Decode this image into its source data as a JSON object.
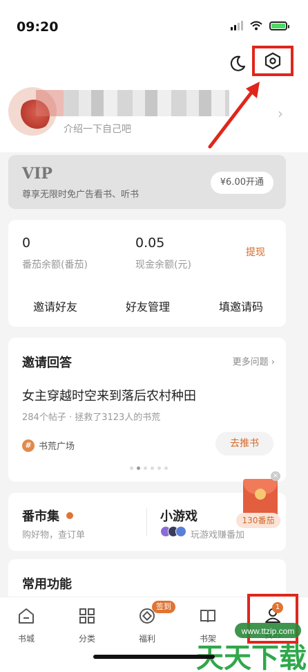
{
  "status_bar": {
    "time": "09:20"
  },
  "profile": {
    "bio": "介绍一下自己吧"
  },
  "vip": {
    "title": "VIP",
    "subtitle": "尊享无限时免广告看书、听书",
    "button": "¥6.00开通"
  },
  "wallet": {
    "tomato_balance": "0",
    "tomato_label": "番茄余额(番茄)",
    "cash_balance": "0.05",
    "cash_label": "现金余额(元)",
    "withdraw": "提现",
    "actions": [
      "邀请好友",
      "好友管理",
      "填邀请码"
    ]
  },
  "invite_answer": {
    "title": "邀请回答",
    "more": "更多问题",
    "question": "女主穿越时空来到落后农村种田",
    "meta": "284个帖子 · 拯救了3123人的书荒",
    "tag": "书荒广场",
    "recommend": "去推书"
  },
  "market": {
    "title": "番市集",
    "subtitle": "购好物，查订单"
  },
  "games": {
    "title": "小游戏",
    "subtitle": "玩游戏赚番加"
  },
  "red_packet": {
    "label": "130番茄"
  },
  "common_functions": {
    "title": "常用功能"
  },
  "tabbar": {
    "items": [
      "书城",
      "分类",
      "福利",
      "书架",
      "我的"
    ],
    "welfare_badge": "签到",
    "mine_badge": "1"
  },
  "watermark": {
    "text": "天天下载",
    "url": "www.ttzip.com"
  },
  "colors": {
    "accent": "#e07434",
    "highlight_red": "#e0261b"
  }
}
